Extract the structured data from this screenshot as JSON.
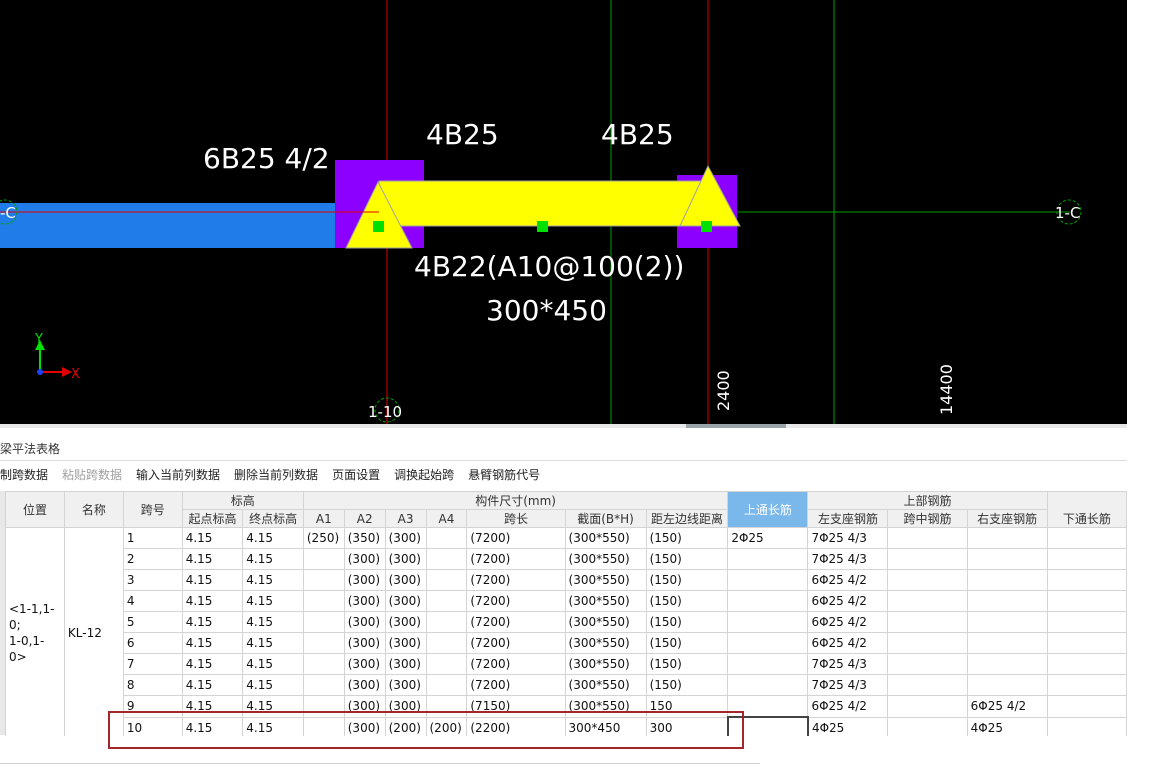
{
  "cad": {
    "top_left_label": "6B25 4/2",
    "top_mid_label": "4B25",
    "top_right_label": "4B25",
    "beam_below_label": "4B22(A10@100(2))",
    "beam_size_label": "300*450",
    "axis_left": "-C",
    "axis_right": "1-C",
    "axis_bottom": "1-10",
    "dim_vertical_1": "2400",
    "dim_vertical_2": "14400",
    "ucs_y": "Y",
    "ucs_x": "X",
    "colors": {
      "background": "#000000",
      "beam_fill": "#ffff00",
      "column_fill": "#8c00ff",
      "neighbor_beam": "#1f7ce8",
      "grip": "#00e000",
      "axis_red": "#e00000",
      "axis_green": "#00a000"
    }
  },
  "panel": {
    "title": "梁平法表格",
    "toolbar": [
      "复制跨数据",
      "粘贴跨数据",
      "输入当前列数据",
      "删除当前列数据",
      "页面设置",
      "调换起始跨",
      "悬臂钢筋代号"
    ],
    "toolbar_disabled": [
      false,
      true,
      false,
      false,
      false,
      false,
      false
    ]
  },
  "table": {
    "group_headers": {
      "elev": "标高",
      "size": "构件尺寸(mm)",
      "top_rebar": "上部钢筋"
    },
    "headers": {
      "position": "位置",
      "name": "名称",
      "span": "跨号",
      "start_elev": "起点标高",
      "end_elev": "终点标高",
      "a1": "A1",
      "a2": "A2",
      "a3": "A3",
      "a4": "A4",
      "span_len": "跨长",
      "section": "截面(B*H)",
      "offset": "距左边线距离",
      "top_cont": "上通长筋",
      "left_sup": "左支座钢筋",
      "mid": "跨中钢筋",
      "right_sup": "右支座钢筋",
      "bottom_cont": "下通长筋"
    },
    "position": "<1-1,1-0;\n1-0,1-0>",
    "name": "KL-12",
    "rows": [
      {
        "span": "1",
        "start": "4.15",
        "end": "4.15",
        "a1": "(250)",
        "a2": "(350)",
        "a3": "(300)",
        "a4": "",
        "len": "(7200)",
        "sec": "(300*550)",
        "off": "(150)",
        "top": "2Φ25",
        "left": "7Φ25 4/3",
        "mid": "",
        "right": "",
        "bot": ""
      },
      {
        "span": "2",
        "start": "4.15",
        "end": "4.15",
        "a1": "",
        "a2": "(300)",
        "a3": "(300)",
        "a4": "",
        "len": "(7200)",
        "sec": "(300*550)",
        "off": "(150)",
        "top": "",
        "left": "7Φ25 4/3",
        "mid": "",
        "right": "",
        "bot": ""
      },
      {
        "span": "3",
        "start": "4.15",
        "end": "4.15",
        "a1": "",
        "a2": "(300)",
        "a3": "(300)",
        "a4": "",
        "len": "(7200)",
        "sec": "(300*550)",
        "off": "(150)",
        "top": "",
        "left": "6Φ25 4/2",
        "mid": "",
        "right": "",
        "bot": ""
      },
      {
        "span": "4",
        "start": "4.15",
        "end": "4.15",
        "a1": "",
        "a2": "(300)",
        "a3": "(300)",
        "a4": "",
        "len": "(7200)",
        "sec": "(300*550)",
        "off": "(150)",
        "top": "",
        "left": "6Φ25 4/2",
        "mid": "",
        "right": "",
        "bot": ""
      },
      {
        "span": "5",
        "start": "4.15",
        "end": "4.15",
        "a1": "",
        "a2": "(300)",
        "a3": "(300)",
        "a4": "",
        "len": "(7200)",
        "sec": "(300*550)",
        "off": "(150)",
        "top": "",
        "left": "6Φ25 4/2",
        "mid": "",
        "right": "",
        "bot": ""
      },
      {
        "span": "6",
        "start": "4.15",
        "end": "4.15",
        "a1": "",
        "a2": "(300)",
        "a3": "(300)",
        "a4": "",
        "len": "(7200)",
        "sec": "(300*550)",
        "off": "(150)",
        "top": "",
        "left": "6Φ25 4/2",
        "mid": "",
        "right": "",
        "bot": ""
      },
      {
        "span": "7",
        "start": "4.15",
        "end": "4.15",
        "a1": "",
        "a2": "(300)",
        "a3": "(300)",
        "a4": "",
        "len": "(7200)",
        "sec": "(300*550)",
        "off": "(150)",
        "top": "",
        "left": "7Φ25 4/3",
        "mid": "",
        "right": "",
        "bot": ""
      },
      {
        "span": "8",
        "start": "4.15",
        "end": "4.15",
        "a1": "",
        "a2": "(300)",
        "a3": "(300)",
        "a4": "",
        "len": "(7200)",
        "sec": "(300*550)",
        "off": "(150)",
        "top": "",
        "left": "7Φ25 4/3",
        "mid": "",
        "right": "",
        "bot": ""
      },
      {
        "span": "9",
        "start": "4.15",
        "end": "4.15",
        "a1": "",
        "a2": "(300)",
        "a3": "(300)",
        "a4": "",
        "len": "(7150)",
        "sec": "(300*550)",
        "off": "150",
        "top": "",
        "left": "6Φ25 4/2",
        "mid": "",
        "right": "6Φ25 4/2",
        "bot": ""
      },
      {
        "span": "10",
        "start": "4.15",
        "end": "4.15",
        "a1": "",
        "a2": "(300)",
        "a3": "(200)",
        "a4": "(200)",
        "len": "(2200)",
        "sec": "300*450",
        "off": "300",
        "top": "",
        "left": "4Φ25",
        "mid": "",
        "right": "4Φ25",
        "bot": ""
      }
    ]
  }
}
